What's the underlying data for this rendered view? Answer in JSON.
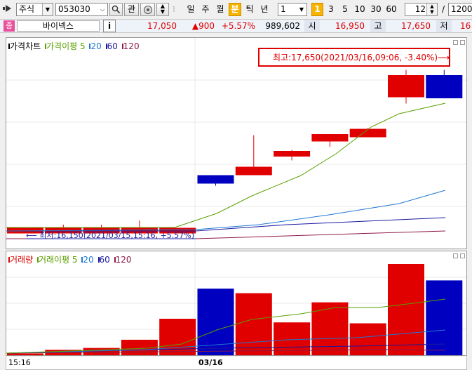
{
  "toolbar": {
    "market": "주식",
    "code": "053030",
    "period_buttons": [
      "일",
      "주",
      "월",
      "분",
      "틱",
      "년"
    ],
    "selected_period": "분",
    "interval_value": "1",
    "minute_buttons": [
      "1",
      "3",
      "5",
      "10",
      "30",
      "60"
    ],
    "selected_minute": "1",
    "count_value": "12",
    "slash": "/",
    "total_value": "1200",
    "search_icon": "magnifier-icon",
    "kwan": "관"
  },
  "infobar": {
    "badge": "종",
    "stock_name": "바이넥스",
    "info_button": "i",
    "price": "17,050",
    "change": "▲900",
    "change_pct": "+5.57%",
    "volume": "989,602",
    "open_label": "시",
    "open": "16,950",
    "high_label": "고",
    "high": "17,650",
    "low_label": "저",
    "low": "16"
  },
  "price_panel": {
    "legend_title": "가격차트",
    "ma_label": "가격이평 5",
    "ma_periods": [
      "20",
      "60",
      "120"
    ],
    "high_annotation": "최고:17,650(2021/03/16,09:06, -3.40%)⟶",
    "low_annotation": "⟵ 최저:16,150(2021/03/15,15:16, +5.57%)"
  },
  "volume_panel": {
    "legend_title": "거래량",
    "ma_label": "거래이평 5",
    "ma_periods": [
      "20",
      "60",
      "120"
    ]
  },
  "xaxis": {
    "left_label": "15:16",
    "date_label": "03/16"
  },
  "colors": {
    "up": "#e00000",
    "down": "#0000c0",
    "ma5": "#5aa000",
    "ma20": "#1e78d2",
    "ma60": "#1a1aa0",
    "ma120": "#8c1a4a",
    "accent": "#f7b500"
  },
  "chart_data": {
    "type": "candlestick",
    "price_range": [
      16100,
      17700
    ],
    "candles": [
      {
        "o": 16150,
        "h": 16150,
        "l": 16100,
        "c": 16150
      },
      {
        "o": 16150,
        "h": 16180,
        "l": 16100,
        "c": 16150
      },
      {
        "o": 16150,
        "h": 16180,
        "l": 16100,
        "c": 16150
      },
      {
        "o": 16150,
        "h": 16220,
        "l": 16100,
        "c": 16150
      },
      {
        "o": 16150,
        "h": 16150,
        "l": 16150,
        "c": 16150
      },
      {
        "o": 16650,
        "h": 16650,
        "l": 16550,
        "c": 16570
      },
      {
        "o": 16650,
        "h": 17030,
        "l": 16650,
        "c": 16730
      },
      {
        "o": 16830,
        "h": 16890,
        "l": 16790,
        "c": 16880
      },
      {
        "o": 16970,
        "h": 17000,
        "l": 16920,
        "c": 17040
      },
      {
        "o": 17010,
        "h": 17100,
        "l": 17100,
        "c": 17090
      },
      {
        "o": 17390,
        "h": 17650,
        "l": 17330,
        "c": 17600
      },
      {
        "o": 17600,
        "h": 17650,
        "l": 17380,
        "c": 17380
      }
    ],
    "volume": [
      2,
      6,
      8,
      17,
      40,
      73,
      68,
      36,
      58,
      35,
      100,
      82
    ]
  }
}
